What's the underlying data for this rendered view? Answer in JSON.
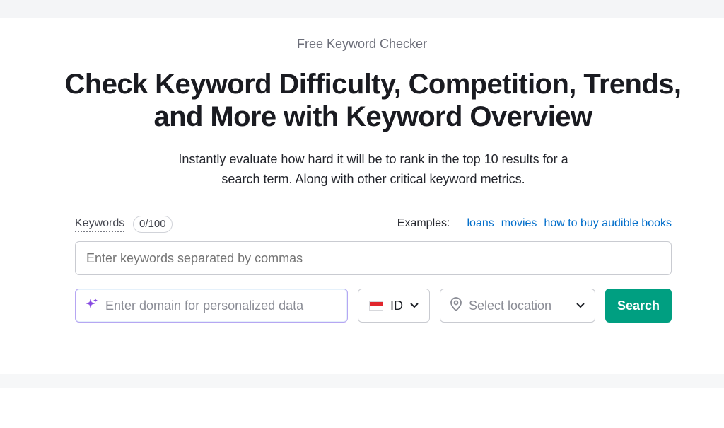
{
  "hero": {
    "eyebrow": "Free Keyword Checker",
    "headline_line1": "Check Keyword Difficulty, Competition, Trends,",
    "headline_line2": "and More with Keyword Overview",
    "subtitle_line1": "Instantly evaluate how hard it will be to rank in the top 10 results for a",
    "subtitle_line2": "search term. Along with other critical keyword metrics."
  },
  "form": {
    "keywords_label": "Keywords",
    "keywords_counter": "0/100",
    "examples_label": "Examples:",
    "examples": [
      "loans",
      "movies",
      "how to buy audible books"
    ],
    "keywords_placeholder": "Enter keywords separated by commas",
    "domain_placeholder": "Enter domain for personalized data",
    "country_code": "ID",
    "location_placeholder": "Select location",
    "search_label": "Search"
  },
  "icons": {
    "sparkle": "sparkle-icon",
    "flag": "indonesia-flag-icon",
    "location": "location-pin-icon",
    "chevron": "chevron-down-icon"
  },
  "colors": {
    "accent": "#009f81",
    "link": "#006dca",
    "sparkle": "#8649e1"
  }
}
